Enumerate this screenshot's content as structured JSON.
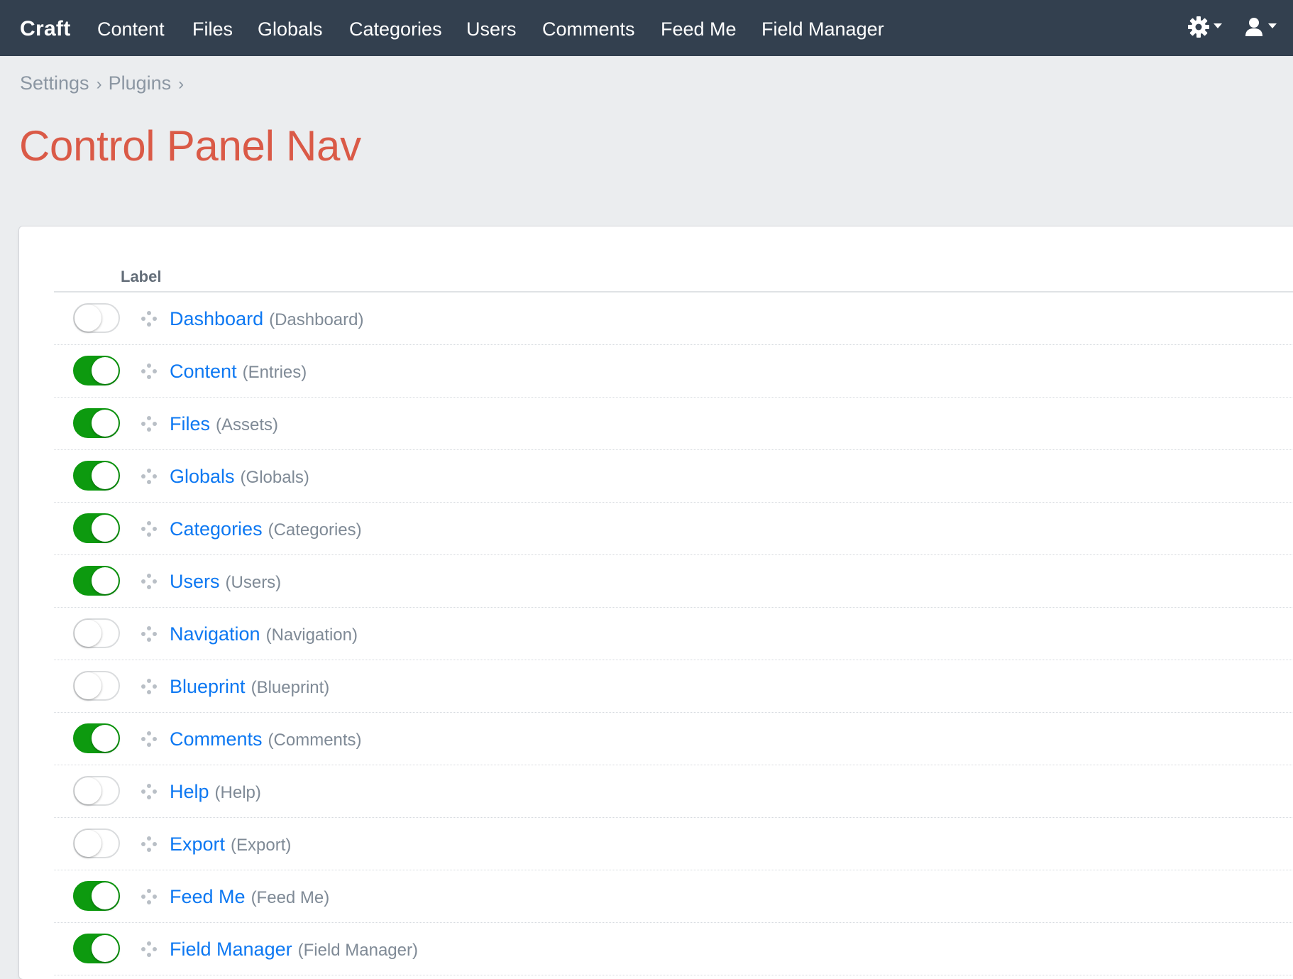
{
  "header": {
    "brand": "Craft",
    "nav": [
      {
        "label": "Content"
      },
      {
        "label": "Files"
      },
      {
        "label": "Globals"
      },
      {
        "label": "Categories"
      },
      {
        "label": "Users"
      },
      {
        "label": "Comments"
      },
      {
        "label": "Feed Me"
      },
      {
        "label": "Field Manager"
      }
    ],
    "tools": [
      "gear-icon",
      "user-icon"
    ]
  },
  "breadcrumb": [
    {
      "label": "Settings"
    },
    {
      "label": "Plugins"
    }
  ],
  "page_title": "Control Panel Nav",
  "table": {
    "column_label": "Label",
    "rows": [
      {
        "label": "Dashboard",
        "handle": "(Dashboard)",
        "enabled": false
      },
      {
        "label": "Content",
        "handle": "(Entries)",
        "enabled": true
      },
      {
        "label": "Files",
        "handle": "(Assets)",
        "enabled": true
      },
      {
        "label": "Globals",
        "handle": "(Globals)",
        "enabled": true
      },
      {
        "label": "Categories",
        "handle": "(Categories)",
        "enabled": true
      },
      {
        "label": "Users",
        "handle": "(Users)",
        "enabled": true
      },
      {
        "label": "Navigation",
        "handle": "(Navigation)",
        "enabled": false
      },
      {
        "label": "Blueprint",
        "handle": "(Blueprint)",
        "enabled": false
      },
      {
        "label": "Comments",
        "handle": "(Comments)",
        "enabled": true
      },
      {
        "label": "Help",
        "handle": "(Help)",
        "enabled": false
      },
      {
        "label": "Export",
        "handle": "(Export)",
        "enabled": false
      },
      {
        "label": "Feed Me",
        "handle": "(Feed Me)",
        "enabled": true
      },
      {
        "label": "Field Manager",
        "handle": "(Field Manager)",
        "enabled": true
      }
    ]
  },
  "colors": {
    "header_bg": "#33404f",
    "title": "#da5a47",
    "link": "#0d78f2",
    "toggle_on": "#0d9a0f"
  }
}
